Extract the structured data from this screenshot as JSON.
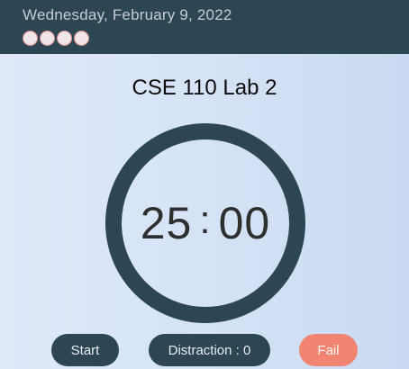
{
  "header": {
    "date": "Wednesday, February 9, 2022",
    "pomo_dots_count": 4,
    "dot_color": "#f1e6e7",
    "background": "#2d4654"
  },
  "main": {
    "title": "CSE 110 Lab 2",
    "timer": {
      "minutes": "25",
      "separator": ":",
      "seconds": "00"
    }
  },
  "controls": {
    "start_label": "Start",
    "distraction_label": "Distraction : 0",
    "fail_label": "Fail"
  },
  "colors": {
    "primary": "#2d4654",
    "fail": "#f28472"
  }
}
